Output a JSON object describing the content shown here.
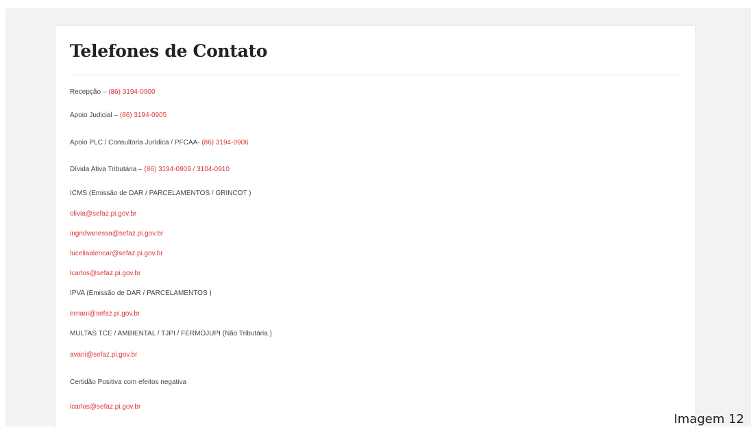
{
  "page": {
    "title": "Telefones de Contato",
    "caption": "Imagem 12"
  },
  "contacts": [
    {
      "label": "Recepção – ",
      "value": "(86) 3194-0900"
    },
    {
      "label": "Apoio Judicial – ",
      "value": "(86) 3194-0905"
    },
    {
      "label": "Apoio PLC / Consultoria Jurídica / PFCAA- ",
      "value": "(86) 3194-0906"
    },
    {
      "label": "Dívida Ativa Tributária – ",
      "value": "(86) 3194-0909 / 3104-0910"
    }
  ],
  "sections": [
    {
      "heading": "ICMS (Emissão de DAR / PARCELAMENTOS / GRINCOT )",
      "emails": [
        "olivia@sefaz.pi.gov.br",
        "ingridvanessa@sefaz.pi.gov.br",
        "luceliaalencar@sefaz.pi.gov.br",
        "lcarlos@sefaz.pi.gov.br"
      ]
    },
    {
      "heading": "IPVA (Emissão de DAR / PARCELAMENTOS )",
      "emails": [
        "ernani@sefaz.pi.gov.br"
      ]
    },
    {
      "heading": "MULTAS TCE / AMBIENTAL / TJPI / FERMOJUPI (Não Tributária )",
      "emails": [
        "avani@sefaz.pi.gov.br"
      ]
    },
    {
      "heading": "Certidão Positiva com efeitos negativa",
      "emails": [
        "lcarlos@sefaz.pi.gov.br"
      ]
    }
  ]
}
